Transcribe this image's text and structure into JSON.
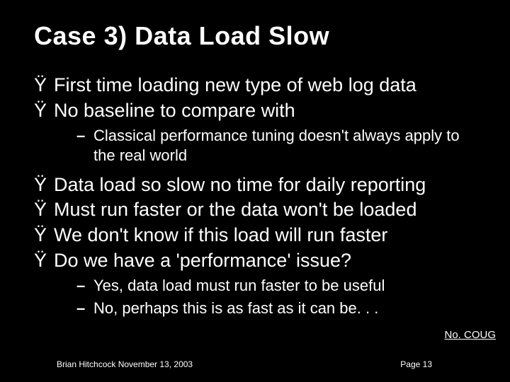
{
  "title": "Case 3) Data Load Slow",
  "bullet_mark": "Ÿ",
  "sub_mark": "–",
  "bullets": {
    "b1": "First time loading new type of web log data",
    "b2": "No baseline to compare with",
    "s1": "Classical performance tuning doesn't always apply to the real world",
    "b3": "Data load so slow no time for daily reporting",
    "b4": "Must run faster or the data won't be loaded",
    "b5": "We don't know if this load will run faster",
    "b6": "Do we have a 'performance' issue?",
    "s2": "Yes, data load must run faster to be useful",
    "s3": "No, perhaps this is as fast as it can be. . ."
  },
  "footer": {
    "org": "No. COUG",
    "author": "Brian Hitchcock  November 13, 2003",
    "page": "Page 13"
  }
}
